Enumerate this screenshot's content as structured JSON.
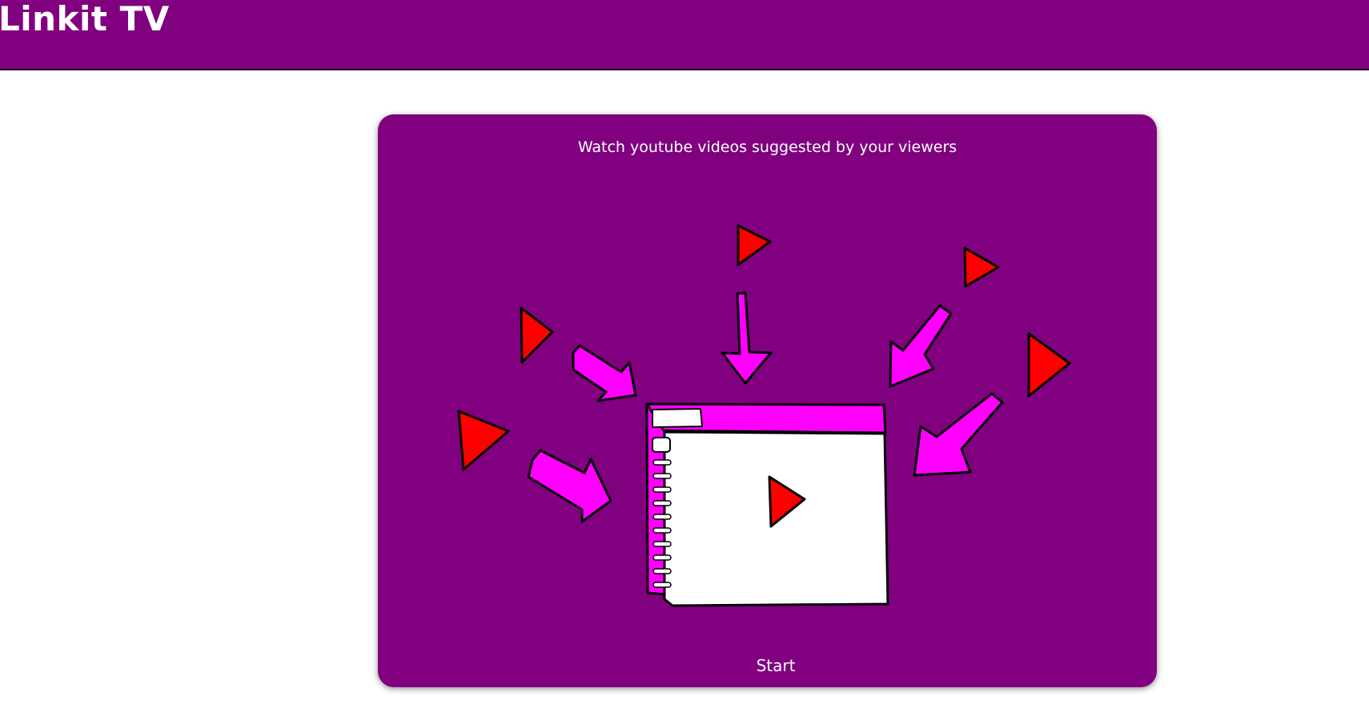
{
  "header": {
    "app_title": "Linkit TV"
  },
  "card": {
    "heading": "Watch youtube videos suggested by your viewers",
    "start_label": "Start",
    "illustration": {
      "icons": [
        "play-icon",
        "arrow-icon",
        "video-player-window-icon"
      ]
    }
  },
  "colors": {
    "brand_purple": "#800080",
    "magenta": "#ff00ff",
    "play_red": "#ff0000",
    "white": "#ffffff",
    "outline": "#000000"
  }
}
